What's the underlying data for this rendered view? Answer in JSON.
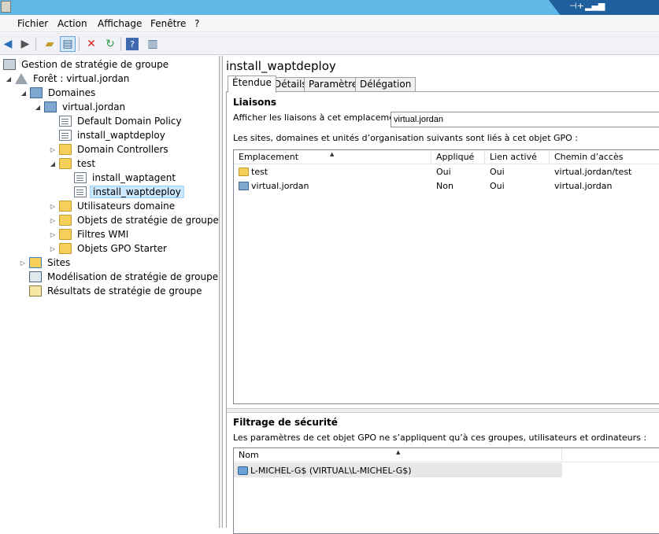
{
  "menu": [
    "Fichier",
    "Action",
    "Affichage",
    "Fenêtre",
    "?"
  ],
  "tree": {
    "root": "Gestion de stratégie de groupe",
    "forest": "Forêt : virtual.jordan",
    "domains": "Domaines",
    "domain": "virtual.jordan",
    "default_policy": "Default Domain Policy",
    "install_waptdeploy": "install_waptdeploy",
    "domain_controllers": "Domain Controllers",
    "test_ou": "test",
    "install_waptagent": "install_waptagent",
    "install_waptdeploy_selected": "install_waptdeploy",
    "utilisateurs": "Utilisateurs domaine",
    "objets_strategie": "Objets de stratégie de groupe",
    "filtres_wmi": "Filtres WMI",
    "objets_starter": "Objets GPO Starter",
    "sites": "Sites",
    "modelisation": "Modélisation de stratégie de groupe",
    "resultats": "Résultats de stratégie de groupe"
  },
  "gpo": {
    "title": "install_waptdeploy",
    "tabs": [
      "Étendue",
      "Détails",
      "Paramètres",
      "Délégation"
    ],
    "liaisons": {
      "title": "Liaisons",
      "location_label": "Afficher les liaisons à cet emplacement :",
      "location_value": "virtual.jordan",
      "description": "Les sites, domaines et unités d’organisation suivants sont liés à cet objet GPO :",
      "columns": [
        "Emplacement",
        "Appliqué",
        "Lien activé",
        "Chemin d’accès"
      ],
      "rows": [
        {
          "emplacement": "test",
          "applique": "Oui",
          "lien": "Oui",
          "chemin": "virtual.jordan/test"
        },
        {
          "emplacement": "virtual.jordan",
          "applique": "Non",
          "lien": "Oui",
          "chemin": "virtual.jordan"
        }
      ]
    },
    "filtrage": {
      "title": "Filtrage de sécurité",
      "description": "Les paramètres de cet objet GPO ne s’appliquent qu’à ces groupes, utilisateurs et ordinateurs :",
      "columns": [
        "Nom"
      ],
      "rows": [
        "L-MICHEL-G$ (VIRTUAL\\L-MICHEL-G$)"
      ]
    }
  }
}
